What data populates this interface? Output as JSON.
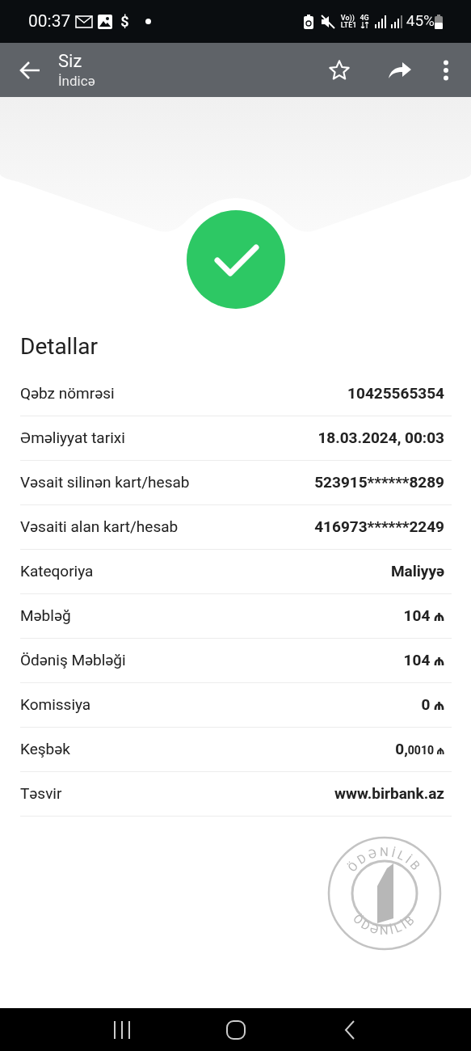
{
  "status_bar": {
    "time": "00:37",
    "dollar": "$",
    "volte_top": "Vo))",
    "volte_bottom": "LTE1",
    "network": "4G",
    "battery": "45%"
  },
  "app_bar": {
    "title": "Siz",
    "subtitle": "İndicə",
    "starred": false
  },
  "success": true,
  "details": {
    "title": "Detallar",
    "rows": [
      {
        "label": "Qəbz nömrəsi",
        "value": "10425565354"
      },
      {
        "label": "Əməliyyat tarixi",
        "value": "18.03.2024, 00:03"
      },
      {
        "label": "Vəsait silinən kart/hesab",
        "value": "523915******8289"
      },
      {
        "label": "Vəsaiti alan kart/hesab",
        "value": "416973******2249"
      },
      {
        "label": "Kateqoriya",
        "value": "Maliyyə"
      },
      {
        "label": "Məbləğ",
        "value": "104 ₼"
      },
      {
        "label": "Ödəniş Məbləği",
        "value": "104 ₼"
      },
      {
        "label": "Komissiya",
        "value": "0 ₼"
      },
      {
        "label": "Keşbək",
        "value": "0,",
        "value_small": "0010 ₼"
      },
      {
        "label": "Təsvir",
        "value": "www.birbank.az"
      }
    ]
  },
  "stamp": {
    "top_text": "ÖDƏNİLİB",
    "bottom_text": "ÖDƏNİLİB"
  }
}
